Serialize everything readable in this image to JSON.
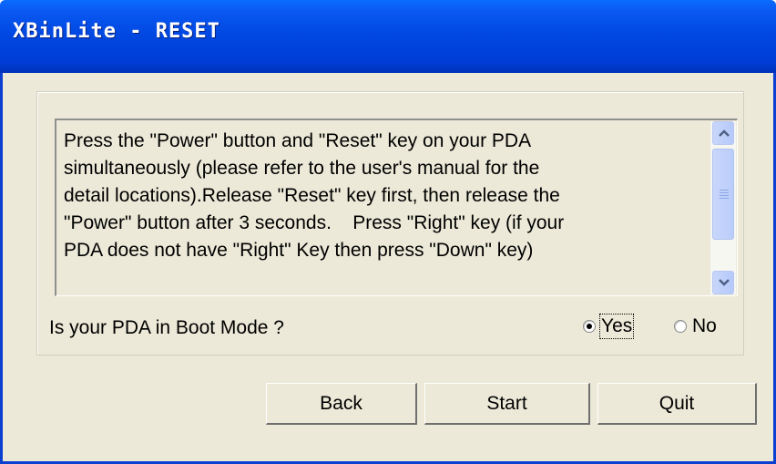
{
  "window": {
    "title": "XBinLite - RESET"
  },
  "instructions": {
    "lines": [
      "Press the \"Power\" button and \"Reset\" key on your PDA",
      "simultaneously (please refer to the user's manual for the",
      "detail locations).Release \"Reset\" key first, then release the",
      "\"Power\" button after 3 seconds.    Press \"Right\" key (if your",
      "PDA does not have \"Right\" Key then press \"Down\" key)"
    ]
  },
  "boot_mode": {
    "question": "Is your PDA in Boot Mode ?",
    "options": [
      {
        "label": "Yes",
        "selected": true
      },
      {
        "label": "No",
        "selected": false
      }
    ]
  },
  "buttons": {
    "back": "Back",
    "start": "Start",
    "quit": "Quit"
  },
  "colors": {
    "titlebar": "#0046e0",
    "face": "#ece9d8",
    "scroll": "#c1d3fb"
  }
}
